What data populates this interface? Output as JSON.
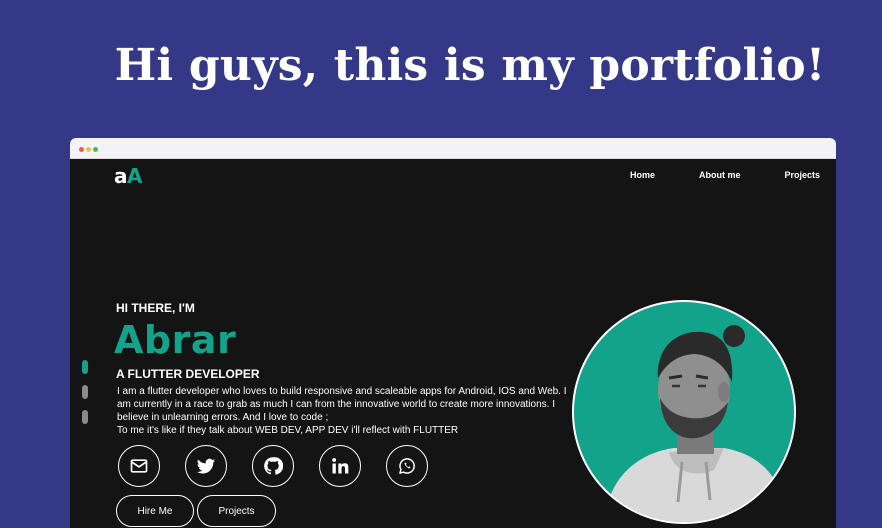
{
  "headline": "Hi guys, this is my portfolio!",
  "site": {
    "logo": {
      "part1": "a",
      "part2": "A"
    },
    "nav": [
      "Home",
      "About me",
      "Projects"
    ]
  },
  "hero": {
    "greeting": "HI THERE, I'M",
    "name": "Abrar",
    "role": "A FLUTTER DEVELOPER",
    "bio_line1": "I am a flutter developer who loves to build responsive and scaleable apps for Android, IOS and Web. I am currently in a race to grab as much I can from the innovative world to create more innovations. I believe in unlearning errors. And I love to code ;",
    "bio_line2": "To me it's like if they talk about WEB DEV, APP DEV i'll reflect with FLUTTER",
    "socials": [
      "mail-icon",
      "twitter-icon",
      "github-icon",
      "linkedin-icon",
      "whatsapp-icon"
    ],
    "buttons": {
      "hire": "Hire Me",
      "projects": "Projects"
    }
  },
  "colors": {
    "background": "#343887",
    "page": "#141414",
    "accent": "#13a38b"
  }
}
